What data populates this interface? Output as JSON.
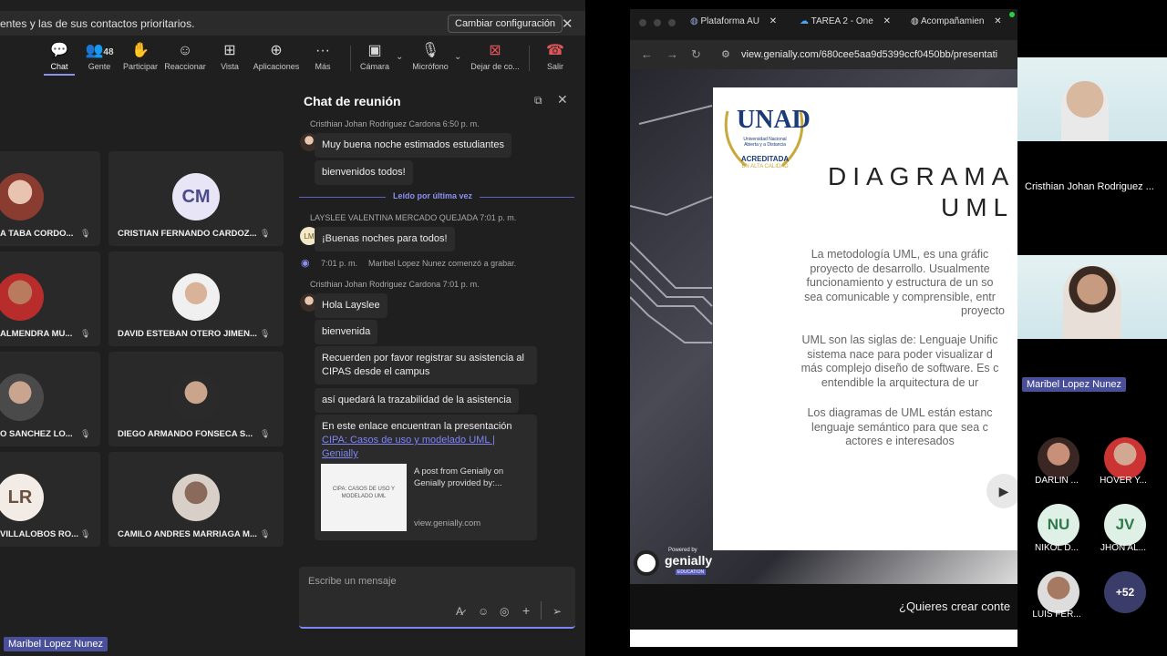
{
  "banner": {
    "text": "entes y las de sus contactos prioritarios.",
    "button": "Cambiar configuración"
  },
  "toolbar": {
    "chat": "Chat",
    "people": "Gente",
    "people_count": "48",
    "raise": "Participar",
    "react": "Reaccionar",
    "view": "Vista",
    "apps": "Aplicaciones",
    "more": "Más",
    "camera": "Cámara",
    "mic": "Micrófono",
    "share": "Dejar de co...",
    "leave": "Salir"
  },
  "tiles": [
    {
      "name": "A TABA CORDO...",
      "initials": ""
    },
    {
      "name": "CRISTIAN FERNANDO CARDOZ...",
      "initials": "CM"
    },
    {
      "name": "ALMENDRA MU...",
      "initials": ""
    },
    {
      "name": "DAVID ESTEBAN OTERO JIMEN...",
      "initials": ""
    },
    {
      "name": "O SANCHEZ LO...",
      "initials": ""
    },
    {
      "name": "DIEGO ARMANDO FONSECA S...",
      "initials": ""
    },
    {
      "name": "VILLALOBOS RO...",
      "initials": "LR"
    },
    {
      "name": "CAMILO ANDRES MARRIAGA M...",
      "initials": ""
    }
  ],
  "presenter_tag": "Maribel  Lopez Nunez",
  "chat": {
    "title": "Chat de reunión",
    "read_label": "Leído por última vez",
    "messages": {
      "m1_meta": "Cristhian Johan Rodriguez Cardona  6:50 p. m.",
      "m1a": "Muy buena noche estimados estudiantes",
      "m1b": "bienvenidos todos!",
      "m2_meta": "LAYSLEE VALENTINA MERCADO QUEJADA  7:01 p. m.",
      "m2_initials": "LM",
      "m2a": "¡Buenas noches para todos!",
      "rec_time": "7:01 p. m.",
      "rec_text": "Maribel  Lopez Nunez  comenzó a grabar.",
      "m3_meta": "Cristhian Johan Rodriguez Cardona  7:01 p. m.",
      "m3a": "Hola Layslee",
      "m3b": "bienvenida",
      "m3c1": "Recuerden por favor registrar su asistencia al",
      "m3c2": "CIPAS desde el campus",
      "m3d": "así quedará la trazabilidad de la asistencia",
      "m3e": "En este enlace encuentran la presentación",
      "m3e_link1": "CIPA: Casos de uso y modelado UML |",
      "m3e_link2": "Genially",
      "preview_title1": "A post from Genially on",
      "preview_title2": "Genially provided by:...",
      "preview_domain": "view.genially.com",
      "preview_thumb": "CIPA: CASOS DE USO Y MODELADO UML"
    },
    "compose_placeholder": "Escribe un mensaje"
  },
  "browser": {
    "tabs": [
      "Plataforma AU",
      "TAREA 2 - One",
      "Acompañamien"
    ],
    "url": "view.genially.com/680cee5aa9d5399ccf0450bb/presentati",
    "slide": {
      "title1": "DIAGRAMA",
      "title2": "UML",
      "p1": [
        "La metodología UML, es una gráfic",
        "proyecto de desarrollo. Usualmente",
        "funcionamiento y estructura de un so",
        "sea comunicable y comprensible, entr",
        "proyecto"
      ],
      "p2": [
        "UML son las siglas de: Lenguaje Unific",
        "sistema nace para poder visualizar d",
        "más complejo diseño de software. Es c",
        "entendible la arquitectura de ur"
      ],
      "p3": [
        "Los diagramas de UML están estanc",
        "lenguaje semántico para que sea c",
        "actores e interesados"
      ],
      "logo": "UNAD",
      "logo_sub1": "Universidad Nacional",
      "logo_sub2": "Abierta y a Distancia",
      "logo_badge1": "ACREDITADA",
      "logo_badge2": "EN ALTA CALIDAD"
    },
    "genially_badge": "genially",
    "genially_powered": "Powered by",
    "genially_edu": "EDUCATION",
    "cta": "¿Quieres crear conte"
  },
  "side": {
    "v1_name": "Cristhian Johan Rodriguez ...",
    "v2_name": "Maribel  Lopez Nunez",
    "people": [
      {
        "name": "DARLIN ...",
        "initials": ""
      },
      {
        "name": "HOVER Y...",
        "initials": ""
      },
      {
        "name": "NIKOL D...",
        "initials": "NU"
      },
      {
        "name": "JHON AL...",
        "initials": "JV"
      },
      {
        "name": "LUIS FER...",
        "initials": ""
      },
      {
        "name": "",
        "initials": "+52"
      }
    ]
  }
}
